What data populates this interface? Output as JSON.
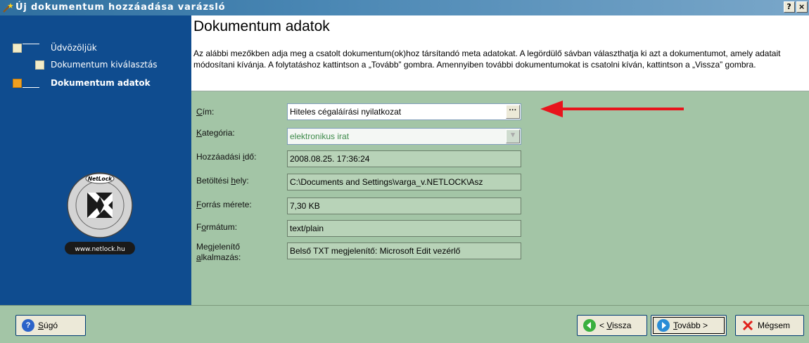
{
  "window": {
    "title": "Új dokumentum hozzáadása varázsló",
    "help_btn": "?",
    "close_btn": "×"
  },
  "sidebar": {
    "steps": [
      {
        "label": "Üdvözöljük",
        "state": "done"
      },
      {
        "label": "Dokumentum kiválasztás",
        "state": "done"
      },
      {
        "label": "Dokumentum adatok",
        "state": "active"
      }
    ],
    "logo": {
      "brand": "NetLock",
      "ring_text": "Az Első Hitelesítés-szolgáltató",
      "url": "www.netlock.hu"
    }
  },
  "header": {
    "title": "Dokumentum adatok",
    "description": "Az alábbi mezőkben adja meg a csatolt dokumentum(ok)hoz társítandó meta adatokat. A legördülő sávban választhatja ki azt a dokumentumot, amely adatait módosítani kívánja. A folytatáshoz kattintson a „Tovább” gombra. Amennyiben további dokumentumokat is csatolni kíván, kattintson a „Vissza” gombra."
  },
  "form": {
    "title": {
      "label_pre": "",
      "label_ul": "C",
      "label_post": "ím:",
      "value": "Hiteles cégaláírási nyilatkozat",
      "button": "···"
    },
    "category": {
      "label_pre": "",
      "label_ul": "K",
      "label_post": "ategória:",
      "value": "elektronikus irat"
    },
    "added_time": {
      "label_pre": "Hozzáadási ",
      "label_ul": "i",
      "label_post": "dő:",
      "value": "2008.08.25. 17:36:24"
    },
    "load_location": {
      "label_pre": "Betöltési ",
      "label_ul": "h",
      "label_post": "ely:",
      "value": "C:\\Documents and Settings\\varga_v.NETLOCK\\Asz"
    },
    "source_size": {
      "label_pre": "",
      "label_ul": "F",
      "label_post": "orrás mérete:",
      "value": "7,30 KB"
    },
    "format": {
      "label_pre": "F",
      "label_ul": "o",
      "label_post": "rmátum:",
      "value": "text/plain"
    },
    "viewer_app": {
      "label_line1": "Megjelenítő",
      "label_ul": "a",
      "label_post": "lkalmazás:",
      "value": "Belső TXT megjelenítő: Microsoft Edit vezérlő"
    }
  },
  "footer": {
    "help": {
      "ul": "S",
      "rest": "úgó"
    },
    "back": {
      "pre": "< ",
      "ul": "V",
      "rest": "issza"
    },
    "next": {
      "ul": "T",
      "rest": "ovább >"
    },
    "cancel": {
      "label": "Mégsem"
    }
  },
  "colors": {
    "sidebar": "#0f4c8f",
    "content": "#a3c5a6",
    "arrow": "#e8141c",
    "active_bullet": "#f0a020"
  }
}
